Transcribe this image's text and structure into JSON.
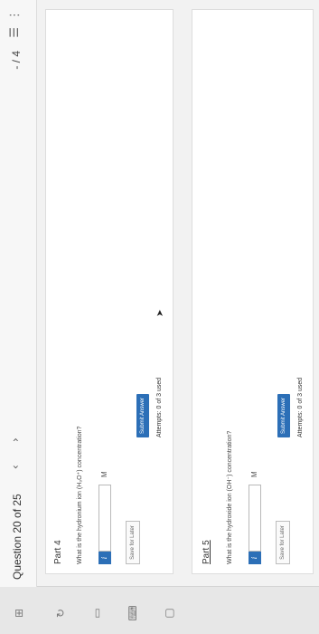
{
  "header": {
    "question_label": "Question 20 of 25",
    "prev_icon": "chevron-left-icon",
    "next_icon": "chevron-right-icon",
    "score": "- / 4",
    "list_icon": "list-icon",
    "more_icon": "more-vertical-icon"
  },
  "parts": [
    {
      "title": "Part 4",
      "question": "What is the hydronium ion (H₃O⁺) concentration?",
      "unit": "M",
      "input_value": "",
      "save_label": "Save for Later",
      "attempts": "Attempts: 0 of 3 used",
      "submit_label": "Submit Answer"
    },
    {
      "title": "Part 5",
      "question": "What is the hydroxide ion (OH⁻) concentration?",
      "unit": "M",
      "input_value": "",
      "save_label": "Save for Later",
      "attempts": "Attempts: 0 of 3 used",
      "submit_label": "Submit Answer"
    }
  ],
  "colors": {
    "accent": "#2c6fb7",
    "background": "#f2f2f2",
    "panel": "#ffffff"
  }
}
